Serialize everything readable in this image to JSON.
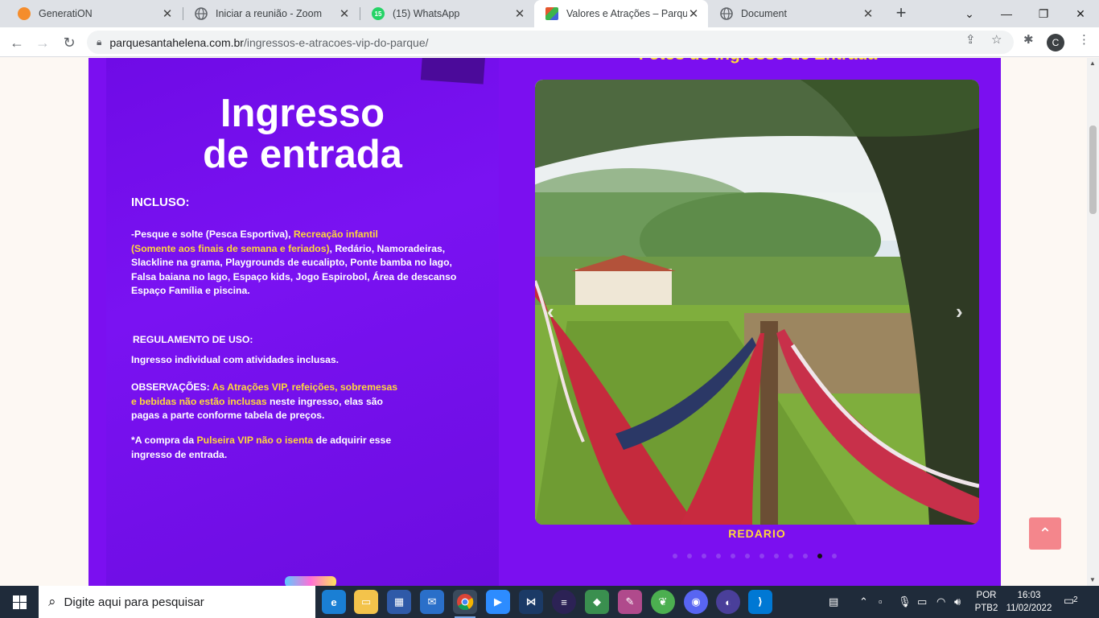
{
  "browser": {
    "tabs": [
      {
        "title": "GeneratiON",
        "icon": "cloud-icon",
        "color": "#f58d2c"
      },
      {
        "title": "Iniciar a reunião - Zoom",
        "icon": "globe-icon",
        "color": "#5f6368"
      },
      {
        "title": "(15) WhatsApp",
        "icon": "whatsapp-icon",
        "color": "#25d366",
        "badge": "15"
      },
      {
        "title": "Valores e Atrações – Parque S",
        "icon": "park-logo-icon",
        "color": "#e4572e",
        "active": true
      },
      {
        "title": "Document",
        "icon": "globe-icon",
        "color": "#5f6368"
      }
    ],
    "new_tab": "+",
    "address": {
      "host": "parquesantahelena.com.br",
      "path": "/ingressos-e-atracoes-vip-do-parque/"
    },
    "profile_initial": "C"
  },
  "page": {
    "ticket": {
      "title_line1": "Ingresso",
      "title_line2": "de entrada",
      "incluso_label": "INCLUSO:",
      "incluso_parts": [
        "-Pesque e solte ",
        "(Pesca Esportiva)",
        ", ",
        "Recreação infantil",
        "(Somente aos finais de semana e feriados)",
        ", Redário, Namoradeiras,",
        "Slackline na grama, Playgrounds de eucalipto, Ponte bamba no lago,",
        "Falsa baiana no lago, Espaço kids, Jogo Espirobol, Área de descanso",
        "Espaço Família",
        " e piscina."
      ],
      "regulamento_label": "REGULAMENTO DE USO:",
      "regulamento_text": "Ingresso individual com atividades inclusas.",
      "obs_label": "OBSERVAÇÕES: ",
      "obs_highlight_1": "As Atrações VIP, refeições, sobremesas",
      "obs_highlight_2": "e bebidas não estão inclusas",
      "obs_rest_1": " neste ingresso, elas são",
      "obs_rest_2": "pagas a parte conforme tabela de preços.",
      "compra_prefix": "*A compra da ",
      "compra_highlight_1": "Pulseira VIP",
      "compra_space": " ",
      "compra_highlight_2": "não o isenta",
      "compra_suffix": " de adquirir esse",
      "compra_line2": "ingresso de entrada."
    },
    "gallery": {
      "heading": "Fotos do Ingresso de Entrada",
      "caption": "REDARIO",
      "prev_arrow": "‹",
      "next_arrow": "›",
      "slide_count": 12,
      "active_slide": 11
    },
    "back_to_top": "⌃"
  },
  "taskbar": {
    "search_placeholder": "Digite aqui para pesquisar",
    "language": [
      "POR",
      "PTB2"
    ],
    "time": "16:03",
    "date": "11/02/2022",
    "notifications": "2"
  }
}
